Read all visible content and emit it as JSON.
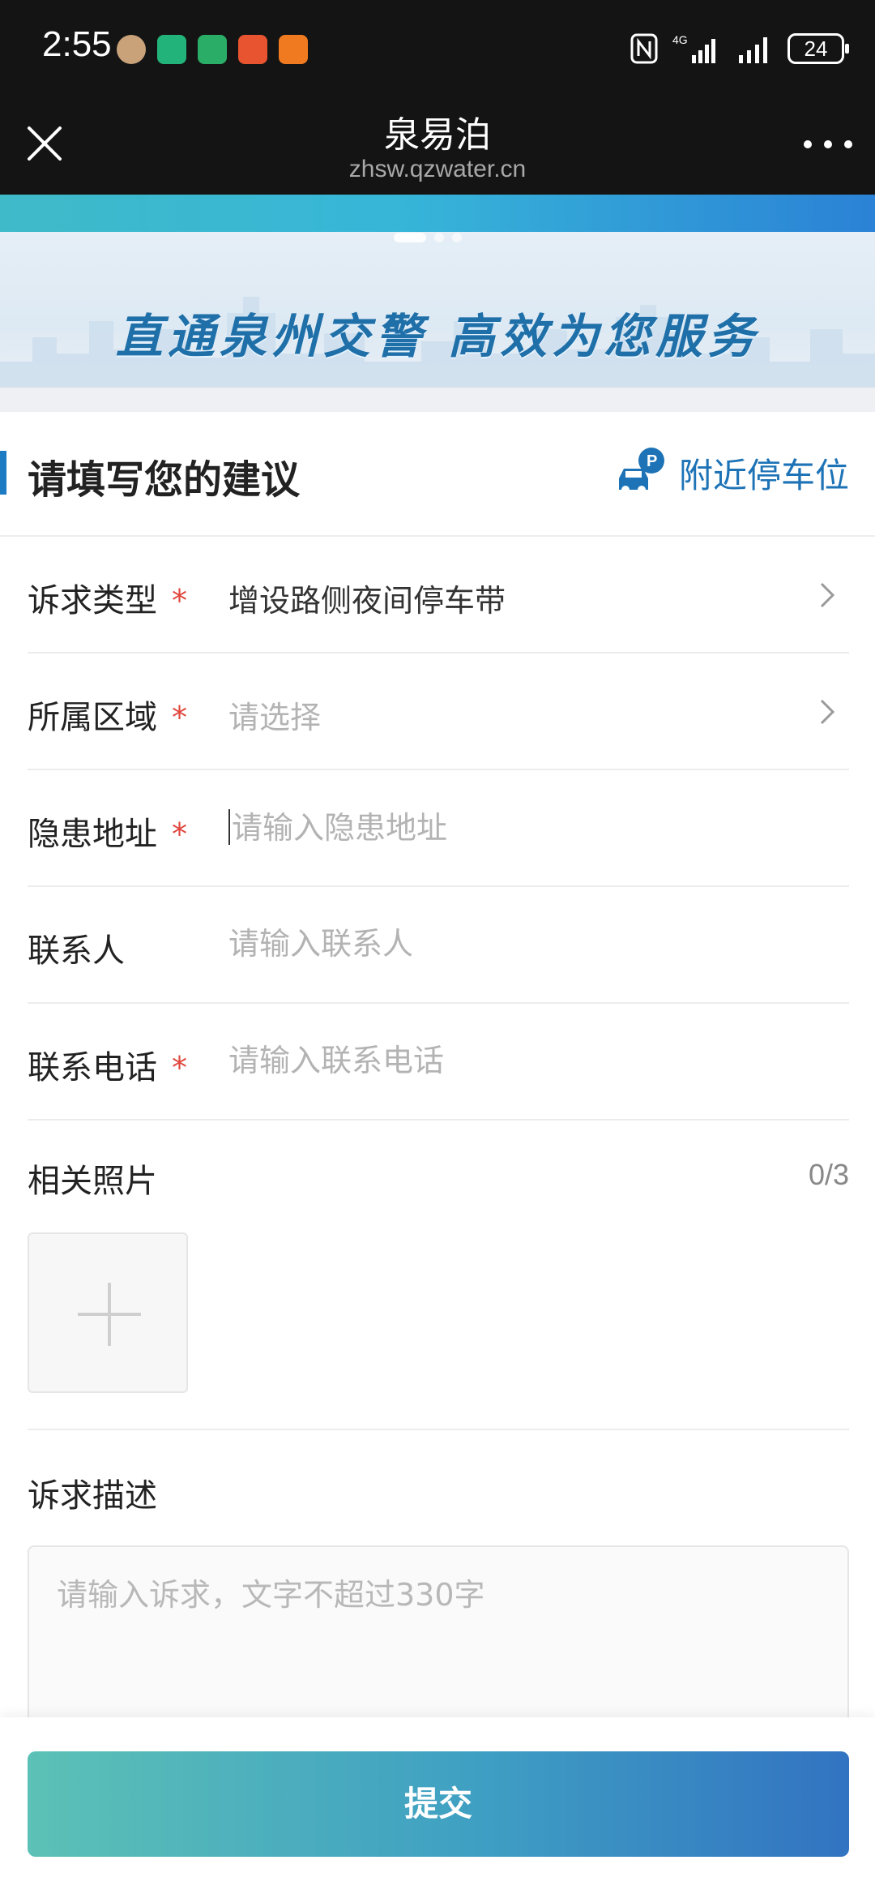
{
  "status_bar": {
    "time": "2:55",
    "battery": "24",
    "network": "4G"
  },
  "title_bar": {
    "title": "泉易泊",
    "url": "zhsw.qzwater.cn"
  },
  "banner": {
    "slogan": "直通泉州交警  高效为您服务",
    "slide_count": 3,
    "active_slide": 1
  },
  "form": {
    "title": "请填写您的建议",
    "nearby_parking": "附近停车位",
    "required_mark": "*",
    "fields": {
      "request_type": {
        "label": "诉求类型",
        "value": "增设路侧夜间停车带"
      },
      "region": {
        "label": "所属区域",
        "placeholder": "请选择"
      },
      "address": {
        "label": "隐患地址",
        "placeholder": "请输入隐患地址"
      },
      "contact": {
        "label": "联系人",
        "placeholder": "请输入联系人"
      },
      "phone": {
        "label": "联系电话",
        "placeholder": "请输入联系电话"
      }
    },
    "photos": {
      "label": "相关照片",
      "count": "0/3"
    },
    "description": {
      "label": "诉求描述",
      "placeholder": "请输入诉求，文字不超过330字"
    },
    "submit_label": "提交"
  },
  "colors": {
    "accent": "#1d7bc4",
    "required": "#e0453c",
    "submit_gradient_start": "#5cc1b6",
    "submit_gradient_end": "#3273c1"
  }
}
